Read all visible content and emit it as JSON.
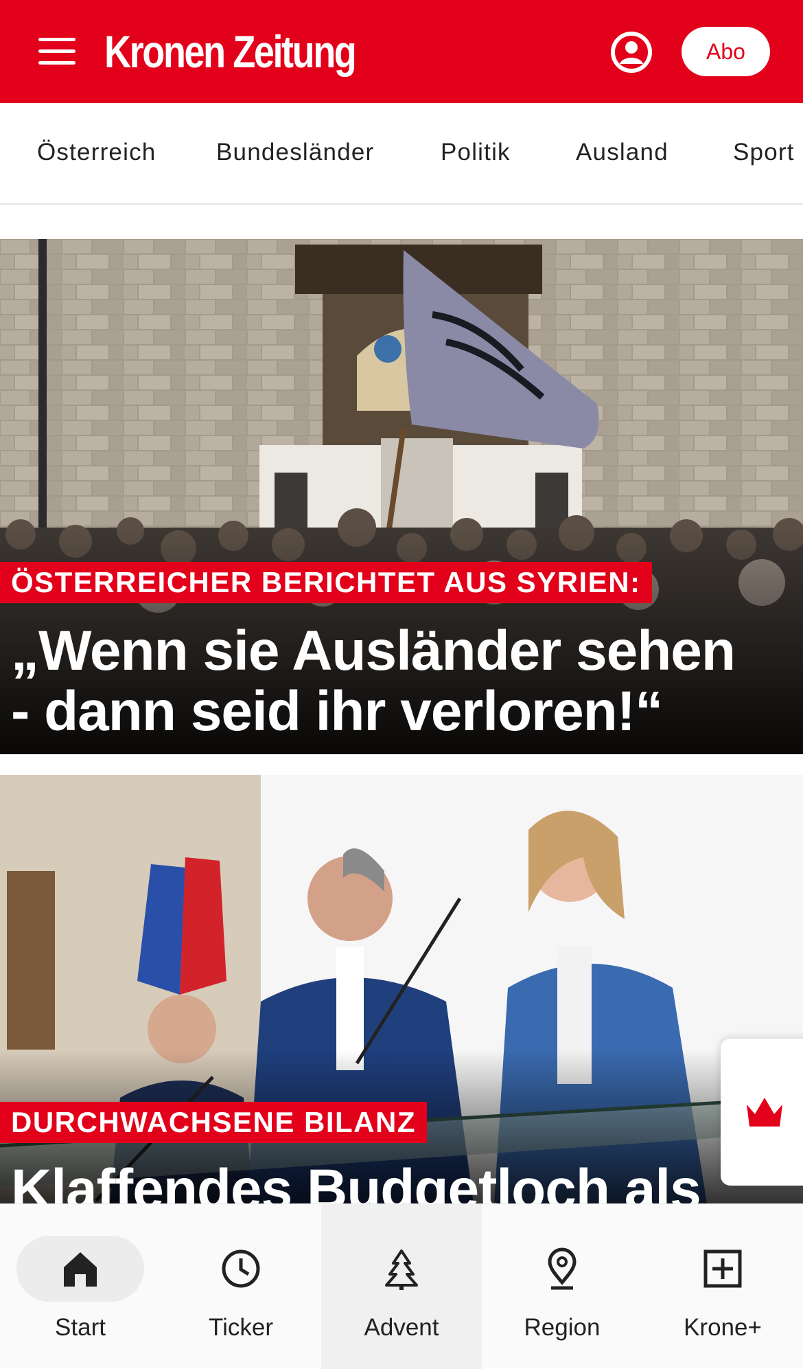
{
  "header": {
    "logo": "Kronen Zeitung",
    "abo_label": "Abo",
    "brand_color": "#e2001a",
    "menu_icon": "hamburger-menu-icon",
    "account_icon": "user-circle-icon"
  },
  "nav": {
    "items": [
      {
        "label": "Österreich"
      },
      {
        "label": "Bundesländer"
      },
      {
        "label": "Politik"
      },
      {
        "label": "Ausland"
      },
      {
        "label": "Sport"
      }
    ]
  },
  "articles": [
    {
      "kicker": "ÖSTERREICHER BERICHTET AUS SYRIEN:",
      "headline_lines": [
        "„Wenn sie Ausländer sehen",
        "- dann seid ihr verloren!“"
      ],
      "image": "crowd-with-flag-in-front-of-mosque"
    },
    {
      "kicker": "DURCHWACHSENE BILANZ",
      "headline_lines": [
        "Klaffendes Budgetloch als"
      ],
      "image": "three-politicians-at-press-conference"
    }
  ],
  "bottom_nav": {
    "items": [
      {
        "label": "Start",
        "icon": "home-icon",
        "active": true
      },
      {
        "label": "Ticker",
        "icon": "clock-icon"
      },
      {
        "label": "Advent",
        "icon": "tree-icon"
      },
      {
        "label": "Region",
        "icon": "location-pin-icon"
      },
      {
        "label": "Krone+",
        "icon": "plus-box-icon"
      }
    ]
  },
  "floating": {
    "icon": "krone-crown-icon"
  }
}
